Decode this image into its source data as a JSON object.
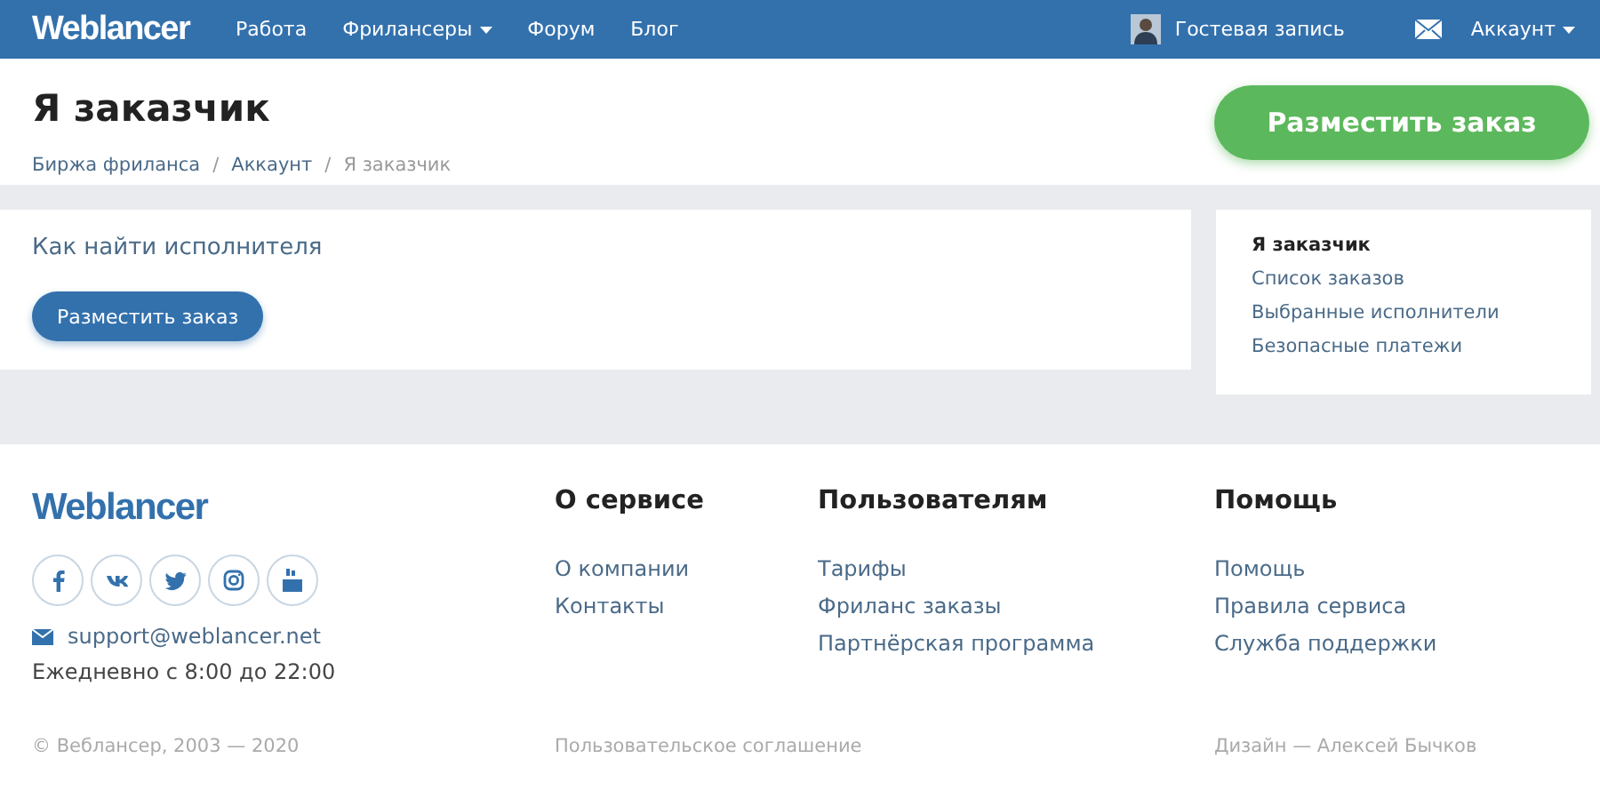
{
  "navbar": {
    "logo": "Weblancer",
    "items": [
      {
        "label": "Работа",
        "dropdown": false
      },
      {
        "label": "Фрилансеры",
        "dropdown": true
      },
      {
        "label": "Форум",
        "dropdown": false
      },
      {
        "label": "Блог",
        "dropdown": false
      }
    ],
    "user": "Гостевая запись",
    "account": {
      "label": "Аккаунт",
      "dropdown": true
    }
  },
  "header": {
    "title": "Я заказчик",
    "separator": "/",
    "breadcrumbs": [
      {
        "label": "Биржа фриланса",
        "current": false
      },
      {
        "label": "Аккаунт",
        "current": false
      },
      {
        "label": "Я заказчик",
        "current": true
      }
    ],
    "button": "Разместить заказ"
  },
  "main": {
    "heading": "Как найти исполнителя",
    "button": "Разместить заказ"
  },
  "sidebar": {
    "items": [
      {
        "label": "Я заказчик",
        "selected": true
      },
      {
        "label": "Список заказов",
        "selected": false
      },
      {
        "label": "Выбранные исполнители",
        "selected": false
      },
      {
        "label": "Безопасные платежи",
        "selected": false
      }
    ]
  },
  "footer": {
    "logo": "Weblancer",
    "socials": [
      {
        "kind": "facebook"
      },
      {
        "kind": "vk"
      },
      {
        "kind": "twitter"
      },
      {
        "kind": "instagram"
      },
      {
        "kind": "youtube"
      }
    ],
    "email": "support@weblancer.net",
    "hours": "Ежедневно с 8:00 до 22:00",
    "columns": [
      {
        "title": "О сервисе",
        "links": [
          "О компании",
          "Контакты"
        ]
      },
      {
        "title": "Пользователям",
        "links": [
          "Тарифы",
          "Фриланс заказы",
          "Партнёрская программа"
        ]
      },
      {
        "title": "Помощь",
        "links": [
          "Помощь",
          "Правила сервиса",
          "Служба поддержки"
        ]
      }
    ],
    "copyright": "© Веблансер, 2003 — 2020",
    "agreement": "Пользовательское соглашение",
    "design": "Дизайн — Алексей Бычков"
  }
}
